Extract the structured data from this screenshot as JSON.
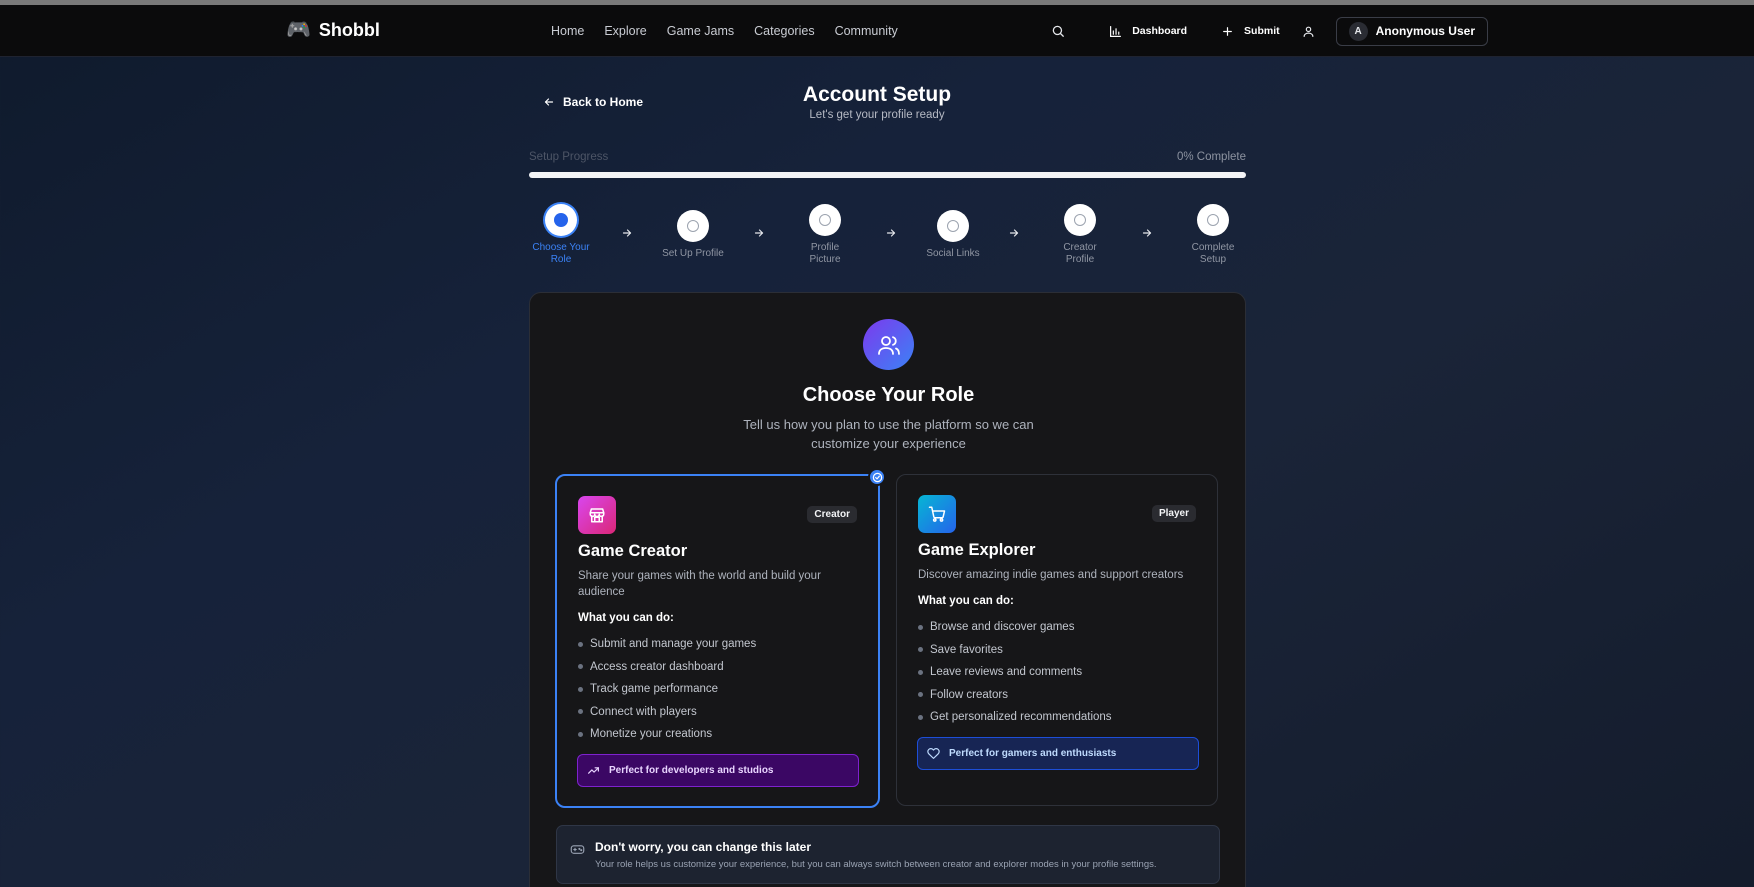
{
  "brand": {
    "logo_icon": "gamepad-icon",
    "name": "Shobbl"
  },
  "nav": {
    "links": [
      "Home",
      "Explore",
      "Game Jams",
      "Categories",
      "Community"
    ],
    "dashboard_label": "Dashboard",
    "submit_label": "Submit",
    "user_initial": "A",
    "user_name": "Anonymous User"
  },
  "header": {
    "back_label": "Back to Home",
    "title": "Account Setup",
    "subtitle": "Let's get your profile ready"
  },
  "progress": {
    "label": "Setup Progress",
    "percent_text": "0% Complete",
    "value": 0
  },
  "steps": [
    {
      "label": "Choose Your Role",
      "active": true
    },
    {
      "label": "Set Up Profile",
      "active": false
    },
    {
      "label": "Profile Picture",
      "active": false
    },
    {
      "label": "Social Links",
      "active": false
    },
    {
      "label": "Creator Profile",
      "active": false
    },
    {
      "label": "Complete Setup",
      "active": false
    }
  ],
  "role_section": {
    "icon": "users-icon",
    "title": "Choose Your Role",
    "description": "Tell us how you plan to use the platform so we can customize your experience"
  },
  "roles": {
    "creator": {
      "selected": true,
      "icon": "store-icon",
      "badge": "Creator",
      "title": "Game Creator",
      "description": "Share your games with the world and build your audience",
      "can_do_label": "What you can do:",
      "features": [
        "Submit and manage your games",
        "Access creator dashboard",
        "Track game performance",
        "Connect with players",
        "Monetize your creations"
      ],
      "footer_icon": "trending-up-icon",
      "footer": "Perfect for developers and studios",
      "accent": "#c026d3"
    },
    "explorer": {
      "selected": false,
      "icon": "cart-icon",
      "badge": "Player",
      "title": "Game Explorer",
      "description": "Discover amazing indie games and support creators",
      "can_do_label": "What you can do:",
      "features": [
        "Browse and discover games",
        "Save favorites",
        "Leave reviews and comments",
        "Follow creators",
        "Get personalized recommendations"
      ],
      "footer_icon": "heart-icon",
      "footer": "Perfect for gamers and enthusiasts",
      "accent": "#0ea5e9"
    }
  },
  "note": {
    "icon": "gamepad-icon",
    "title": "Don't worry, you can change this later",
    "text": "Your role helps us customize your experience, but you can always switch between creator and explorer modes in your profile settings."
  }
}
